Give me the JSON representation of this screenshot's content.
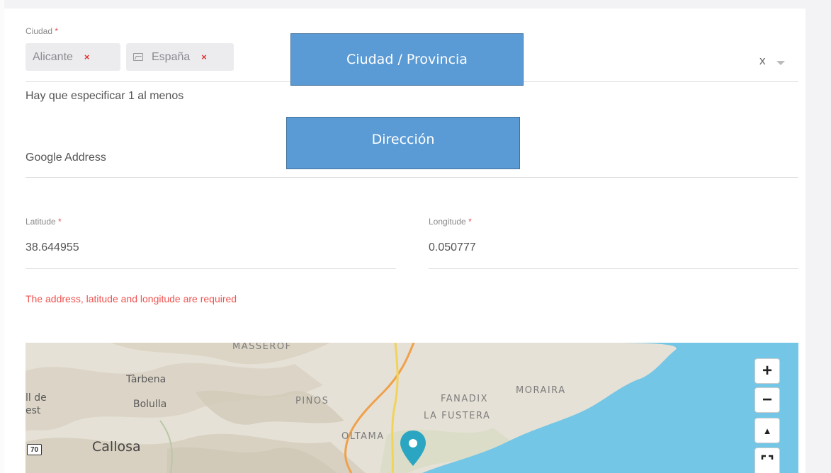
{
  "city_field": {
    "label": "Ciudad",
    "required_mark": "*",
    "chips": [
      {
        "label": "Alicante",
        "remove": "×"
      },
      {
        "label": "España",
        "remove": "×"
      }
    ],
    "clear": "x",
    "helper": "Hay que especificar 1 al menos"
  },
  "address_field": {
    "placeholder": "Google Address"
  },
  "latitude_field": {
    "label": "Latitude",
    "required_mark": "*",
    "value": "38.644955"
  },
  "longitude_field": {
    "label": "Longitude",
    "required_mark": "*",
    "value": "0.050777"
  },
  "error_message": "The address, latitude and longitude are required",
  "callouts": {
    "city": "Ciudad / Provincia",
    "address": "Dirección"
  },
  "map": {
    "labels": {
      "masserof": "MASSEROF",
      "tarbena": "Tàrbena",
      "bolulla": "Bolulla",
      "pinos": "PINOS",
      "fanadix": "FANADIX",
      "moraira": "MORAIRA",
      "la_fustera": "LA FUSTERA",
      "oltamar": "OLTAMA",
      "callosa": "Callosa",
      "edge_top": "ll de",
      "edge_bottom": "est",
      "road": "70"
    },
    "controls": {
      "zoom_in": "+",
      "zoom_out": "−",
      "compass": "▲"
    },
    "colors": {
      "land": "#e6e1d6",
      "sea": "#73c6e6",
      "marker": "#2ba6c2",
      "road_orange": "#f0a04b",
      "road_yellow": "#f2d35a"
    }
  }
}
